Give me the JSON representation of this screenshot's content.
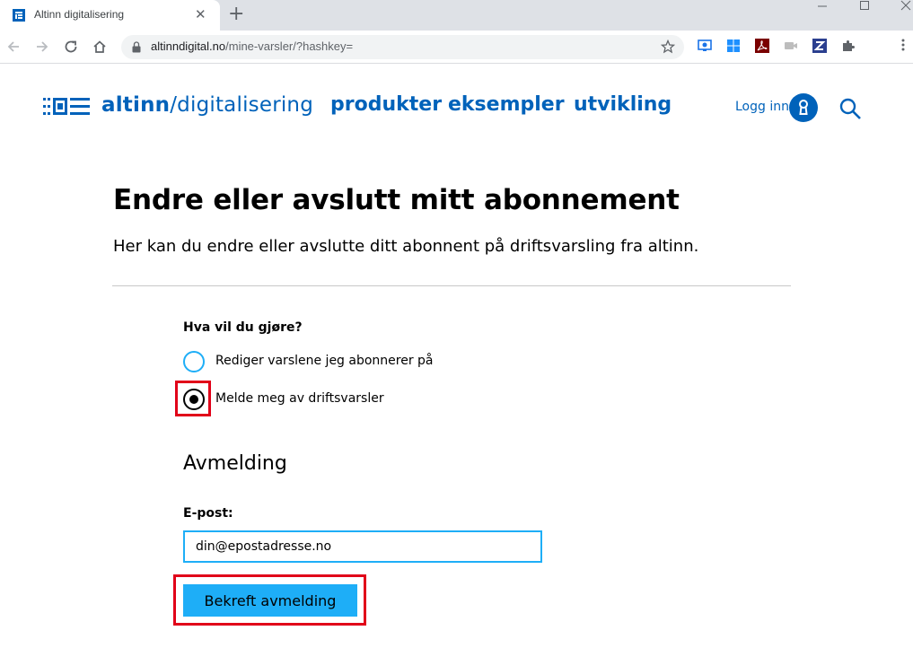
{
  "browser": {
    "tab_title": "Altinn digitalisering",
    "tab_close": "✕",
    "new_tab": "+",
    "url_host": "altinndigital.no",
    "url_path": "/mine-varsler/?hashkey=",
    "icons": [
      "favicon-icon",
      "back-icon",
      "forward-icon",
      "reload-icon",
      "home-icon",
      "lock-icon",
      "star-icon",
      "extension-icons",
      "puzzle-icon",
      "menu-icon"
    ]
  },
  "header": {
    "logo_bold": "altinn",
    "logo_rest": "/digitalisering",
    "nav": [
      {
        "label": "produkter"
      },
      {
        "label": "eksempler"
      },
      {
        "label": "utvikling"
      }
    ],
    "login_label": "Logg inn"
  },
  "page": {
    "title": "Endre eller avslutt mitt abonnement",
    "intro": "Her kan du endre eller avslutte ditt abonnent på driftsvarsling fra altinn.",
    "question": "Hva vil du gjøre?",
    "options": [
      {
        "label": "Rediger varslene jeg abonnerer på",
        "selected": false
      },
      {
        "label": "Melde meg av driftsvarsler",
        "selected": true
      }
    ],
    "section_title": "Avmelding",
    "email_label": "E-post:",
    "email_value": "din@epostadresse.no",
    "confirm_label": "Bekreft avmelding"
  },
  "colors": {
    "brand": "#0062ba",
    "accent": "#1eaef7",
    "highlight": "#e10019"
  }
}
